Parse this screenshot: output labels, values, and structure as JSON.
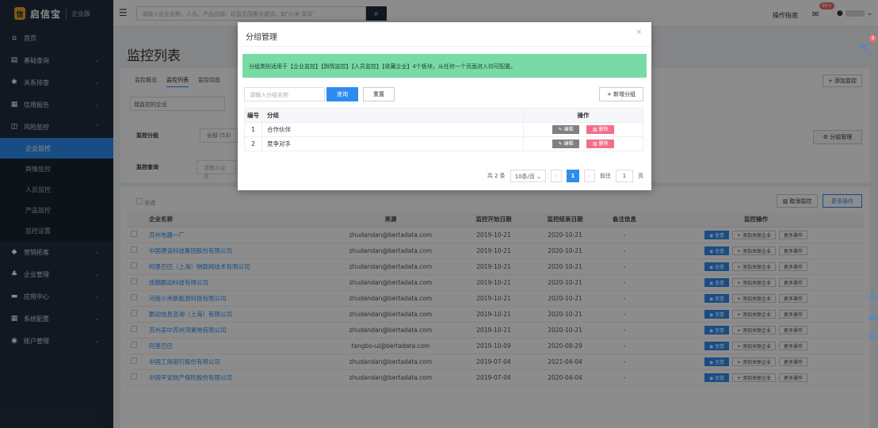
{
  "header": {
    "logo_badge": "信",
    "logo_text": "启信宝",
    "edition": "企业版",
    "search_placeholder": "请输入企业名称、人名、产品品牌、经营范围等关键词，如\"小米 雷军\"",
    "guide": "操作指南",
    "badge_count": "99+"
  },
  "sidebar": {
    "items": [
      {
        "icon": "⌂",
        "label": "首页"
      },
      {
        "icon": "▤",
        "label": "基础查询",
        "arrow": "⌄"
      },
      {
        "icon": "✱",
        "label": "关系排查",
        "arrow": "⌄"
      },
      {
        "icon": "▦",
        "label": "信用报告",
        "arrow": "⌄"
      },
      {
        "icon": "◫",
        "label": "风险监控",
        "arrow": "⌃"
      }
    ],
    "sub_items": [
      "企业监控",
      "舆情监控",
      "人员监控",
      "产品监控",
      "监控设置"
    ],
    "items2": [
      {
        "icon": "◆",
        "label": "营销拓客",
        "arrow": "⌄"
      },
      {
        "icon": "♣",
        "label": "企业管理",
        "arrow": "⌄"
      },
      {
        "icon": "▬",
        "label": "应用中心",
        "arrow": "⌄"
      },
      {
        "icon": "▦",
        "label": "系统配置",
        "arrow": "⌄"
      },
      {
        "icon": "◉",
        "label": "账户管理",
        "arrow": "⌄"
      }
    ]
  },
  "main": {
    "title": "监控列表",
    "tabs": [
      "监控概览",
      "监控列表",
      "监控动态"
    ],
    "add_monitor": "+ 添加监控",
    "select_value": "我监控的企业",
    "filter_group_label": "监控分组",
    "filter_all": "全部 (53)",
    "filter_query_label": "监控查询",
    "filter_query_placeholder": "请输入企业",
    "group_mgmt": "⚙ 分组管理",
    "select_all": "全选",
    "cancel_monitor": "▥ 取消监控",
    "more_ops": "更多操作",
    "table": {
      "headers": [
        "企业名称",
        "来源",
        "监控开始日期",
        "监控结束日期",
        "备注信息",
        "监控操作"
      ],
      "op_buttons": [
        "◉ 查看",
        "+ 添加关联企业",
        "更多操作"
      ],
      "rows": [
        {
          "name": "苏州电器一厂",
          "source": "zhudandan@bertadata.com",
          "start": "2019-10-21",
          "end": "2020-10-21",
          "note": "-"
        },
        {
          "name": "中国建设科技集团股份有限公司",
          "source": "zhudandan@bertadata.com",
          "start": "2019-10-21",
          "end": "2020-10-21",
          "note": "-"
        },
        {
          "name": "阿里巴巴（上海）物联网技术有限公司",
          "source": "zhudandan@bertadata.com",
          "start": "2019-10-21",
          "end": "2020-10-21",
          "note": "-"
        },
        {
          "name": "成都鹏动科技有限公司",
          "source": "zhudandan@bertadata.com",
          "start": "2019-10-21",
          "end": "2020-10-21",
          "note": "-"
        },
        {
          "name": "河南小米新能源科技有限公司",
          "source": "zhudandan@bertadata.com",
          "start": "2019-10-21",
          "end": "2020-10-21",
          "note": "-"
        },
        {
          "name": "鹏动信息咨询（上海）有限公司",
          "source": "zhudandan@bertadata.com",
          "start": "2019-10-21",
          "end": "2020-10-21",
          "note": "-"
        },
        {
          "name": "苏州吴中苏州湾置地有限公司",
          "source": "zhudandan@bertadata.com",
          "start": "2019-10-21",
          "end": "2020-10-21",
          "note": "-"
        },
        {
          "name": "阿里巴巴",
          "source": "tangbo-ui@bertadata.com",
          "start": "2019-10-09",
          "end": "2020-08-29",
          "note": "-"
        },
        {
          "name": "中国工商银行股份有限公司",
          "source": "zhudandan@bertadata.com",
          "start": "2019-07-04",
          "end": "2021-04-04",
          "note": "-"
        },
        {
          "name": "中国平安财产保险股份有限公司",
          "source": "zhudandan@bertadata.com",
          "start": "2019-07-04",
          "end": "2020-04-04",
          "note": "-"
        }
      ]
    }
  },
  "floating": {
    "share_badge": "9",
    "items": [
      "APP",
      "客服",
      "顶部"
    ]
  },
  "modal": {
    "title": "分组管理",
    "close": "×",
    "notice": "分组类别适用于【企业监控】【舆情监控】【人员监控】【收藏企业】4个板块，从任何一个页面进入均可配置。",
    "input_placeholder": "请输入分组名称",
    "query": "查询",
    "reset": "重置",
    "add_group": "+ 新增分组",
    "headers": [
      "编号",
      "分组",
      "操作"
    ],
    "rows": [
      {
        "no": "1",
        "name": "合作伙伴"
      },
      {
        "no": "2",
        "name": "竞争对手"
      }
    ],
    "edit": "✎ 编辑",
    "delete": "▥ 删除",
    "pager": {
      "total": "共 2 条",
      "size": "10条/页 ⌄",
      "prev": "‹",
      "page": "1",
      "next": "›",
      "goto_prefix": "前往",
      "goto_value": "1",
      "goto_suffix": "页"
    }
  }
}
